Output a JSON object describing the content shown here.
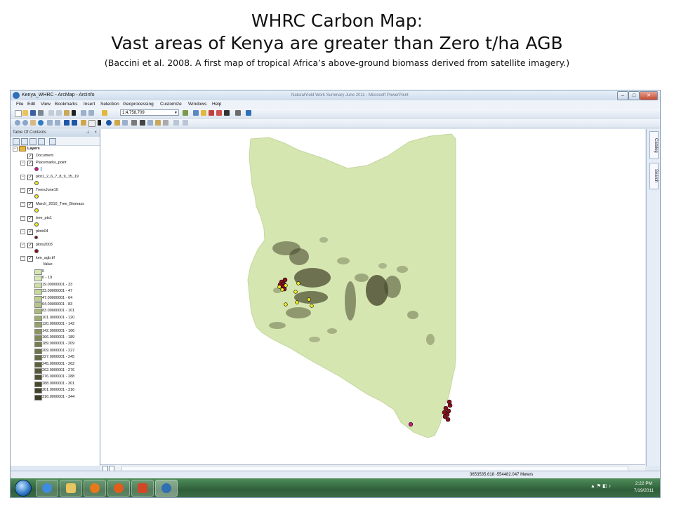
{
  "slide": {
    "title_line1": "WHRC Carbon Map:",
    "title_line2": "Vast areas of Kenya are greater than Zero t/ha AGB",
    "citation": "(Baccini et al. 2008. A first map of tropical Africa’s above-ground biomass derived from satellite imagery.)"
  },
  "window": {
    "title": "Kenya_WHRC - ArcMap - ArcInfo",
    "background_app_title": "NaturalYield Work Summary June 2011 - Microsoft PowerPoint",
    "controls": {
      "minimize": "–",
      "maximize": "□",
      "close": "✕"
    }
  },
  "menu": [
    "File",
    "Edit",
    "View",
    "Bookmarks",
    "Insert",
    "Selection",
    "Geoprocessing",
    "Customize",
    "Windows",
    "Help"
  ],
  "toolbar": {
    "scale_value": "1:4,758,709"
  },
  "toc": {
    "title": "Table Of Contents",
    "pin": "⊥",
    "close": "×",
    "root": "Layers",
    "layers": [
      {
        "name": "Document",
        "symbol": "none"
      },
      {
        "name": "Placemarks_point",
        "symbol": "magenta-dot"
      },
      {
        "name": "plot1_2_6_7_8_9_15_19",
        "symbol": "yellow-dot"
      },
      {
        "name": "TreesJune10",
        "symbol": "yellow-dot"
      },
      {
        "name": "March_2010_Tree_Biomass",
        "symbol": "yellow-dot"
      },
      {
        "name": "tree_pts1",
        "symbol": "yellow-dot"
      },
      {
        "name": "plots04",
        "symbol": "maroon-dot"
      },
      {
        "name": "plots2003",
        "symbol": "maroon-dot"
      },
      {
        "name": "ken_agb.tif",
        "symbol": "raster"
      }
    ],
    "raster_value_label": "Value",
    "classes": [
      {
        "label": "0",
        "color": "#d4e6b0"
      },
      {
        "label": "0 - 19",
        "color": "#d7e8b5"
      },
      {
        "label": "19.00000001 - 33",
        "color": "#cfe0a6"
      },
      {
        "label": "33.00000001 - 47",
        "color": "#c6d89a"
      },
      {
        "label": "47.00000001 - 64",
        "color": "#bdd08f"
      },
      {
        "label": "64.00000001 - 83",
        "color": "#b3c585"
      },
      {
        "label": "83.00000001 - 101",
        "color": "#a9ba7b"
      },
      {
        "label": "101.0000001 - 120",
        "color": "#9eae72"
      },
      {
        "label": "120.0000001 - 142",
        "color": "#94a269"
      },
      {
        "label": "142.0000001 - 166",
        "color": "#8a9660"
      },
      {
        "label": "166.0000001 - 189",
        "color": "#808a58"
      },
      {
        "label": "189.0000001 - 209",
        "color": "#777f50"
      },
      {
        "label": "209.0000001 - 227",
        "color": "#6e7449"
      },
      {
        "label": "227.0000001 - 245",
        "color": "#666a43"
      },
      {
        "label": "245.0000001 - 262",
        "color": "#5e613d"
      },
      {
        "label": "262.0000001 - 276",
        "color": "#575838"
      },
      {
        "label": "276.0000001 - 288",
        "color": "#505033"
      },
      {
        "label": "288.0000001 - 301",
        "color": "#49492f"
      },
      {
        "label": "301.0000001 - 316",
        "color": "#43422b"
      },
      {
        "label": "316.0000001 - 344",
        "color": "#3d3c28"
      }
    ]
  },
  "dock": {
    "catalog": "Catalog",
    "search": "Search"
  },
  "status": {
    "coordinates": "3653535.618  -554482.047 Meters"
  },
  "taskbar": {
    "time": "2:22 PM",
    "date": "7/19/2011"
  },
  "colors": {
    "kenya_fill": "#d6e6b1",
    "kenya_stroke": "#c3d79e",
    "dense_biomass": "#4a4a2f",
    "placemark_magenta": "#d0148c",
    "plot_yellow": "#f2ea1a",
    "plot_maroon": "#8a0f1a"
  }
}
